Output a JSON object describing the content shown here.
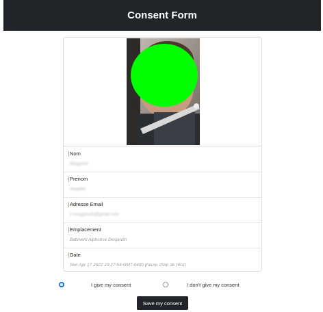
{
  "header": {
    "title": "Consent Form"
  },
  "photo": {
    "description_icon": "person-photo-icon"
  },
  "fields": [
    {
      "label": "Nom",
      "value": "Moggoch"
    },
    {
      "label": "Prenom",
      "value": "Awaefet"
    },
    {
      "label": "Adresse Email",
      "value": "n.moggouch@gmail.com"
    },
    {
      "label": "Emplacement",
      "value": "Batiment Alphonse Desjardin"
    },
    {
      "label": "Date",
      "value": "Sun Apr 17 2022 23:27:53 GMT-0400 (heure d’été de l’Est)"
    }
  ],
  "consent": {
    "give_label": "I give my consent",
    "deny_label": "I don't give my consent",
    "selected": "give"
  },
  "save_button": {
    "label": "Save my consent"
  },
  "colors": {
    "header_bg": "#212529",
    "radio_accent": "#1a73e8",
    "button_bg": "#212529"
  }
}
